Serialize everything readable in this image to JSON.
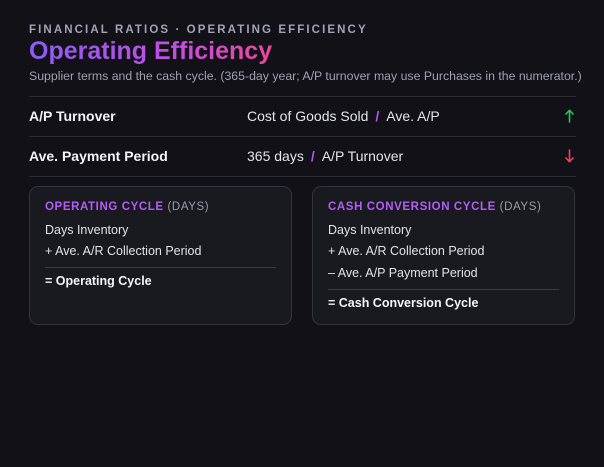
{
  "header": {
    "eyebrow": "FINANCIAL RATIOS · OPERATING EFFICIENCY",
    "title": "Operating Efficiency",
    "subtitle": "Supplier terms and the cash cycle. (365-day year; A/P turnover may use Purchases in the numerator.)"
  },
  "ratios": [
    {
      "label": "A/P Turnover",
      "numerator": "Cost of Goods Sold",
      "separator": "/",
      "denominator": "Ave. A/P",
      "direction_icon": "arrow-up-icon",
      "direction_color": "#22c55e"
    },
    {
      "label": "Ave. Payment Period",
      "numerator": "365 days",
      "separator": "/",
      "denominator": "A/P Turnover",
      "direction_icon": "arrow-down-icon",
      "direction_color": "#f43f5e"
    }
  ],
  "cards": {
    "operating_cycle": {
      "title": "OPERATING CYCLE",
      "unit": "(DAYS)",
      "lines": [
        "Days Inventory",
        "+ Ave. A/R Collection Period"
      ],
      "result": "= Operating Cycle"
    },
    "cash_conversion_cycle": {
      "title": "CASH CONVERSION CYCLE",
      "unit": "(DAYS)",
      "lines": [
        "Days Inventory",
        "+ Ave. A/R Collection Period",
        "– Ave. A/P Payment Period"
      ],
      "result": "= Cash Conversion Cycle"
    }
  },
  "colors": {
    "background": "#111117",
    "accent_purple": "#b45ef6",
    "title_gradient_start": "#8b5cf6",
    "title_gradient_end": "#ec4899",
    "up_green": "#22c55e",
    "down_red": "#f43f5e"
  }
}
